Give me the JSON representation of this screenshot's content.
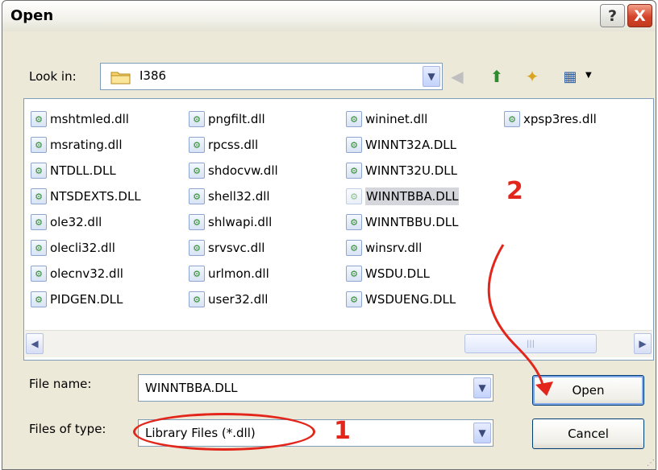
{
  "dialog": {
    "title": "Open",
    "help_symbol": "?",
    "close_symbol": "X"
  },
  "lookin": {
    "label": "Look in:",
    "value": "I386"
  },
  "toolbar": {
    "icons": [
      "back-icon",
      "up-folder-icon",
      "new-folder-icon",
      "views-menu-icon"
    ]
  },
  "files": {
    "columns": [
      [
        "mshtmled.dll",
        "msrating.dll",
        "NTDLL.DLL",
        "NTSDEXTS.DLL",
        "ole32.dll",
        "olecli32.dll",
        "olecnv32.dll",
        "PIDGEN.DLL"
      ],
      [
        "pngfilt.dll",
        "rpcss.dll",
        "shdocvw.dll",
        "shell32.dll",
        "shlwapi.dll",
        "srvsvc.dll",
        "urlmon.dll",
        "user32.dll"
      ],
      [
        "wininet.dll",
        "WINNT32A.DLL",
        "WINNT32U.DLL",
        "WINNTBBA.DLL",
        "WINNTBBU.DLL",
        "winsrv.dll",
        "WSDU.DLL",
        "WSDUENG.DLL"
      ],
      [
        "xpsp3res.dll"
      ]
    ],
    "selected": "WINNTBBA.DLL"
  },
  "filename": {
    "label": "File name:",
    "value": "WINNTBBA.DLL"
  },
  "filetype": {
    "label": "Files of type:",
    "value": "Library Files (*.dll)"
  },
  "buttons": {
    "open": "Open",
    "cancel": "Cancel"
  },
  "annotations": {
    "one": "1",
    "two": "2",
    "color": "#e3261b"
  }
}
